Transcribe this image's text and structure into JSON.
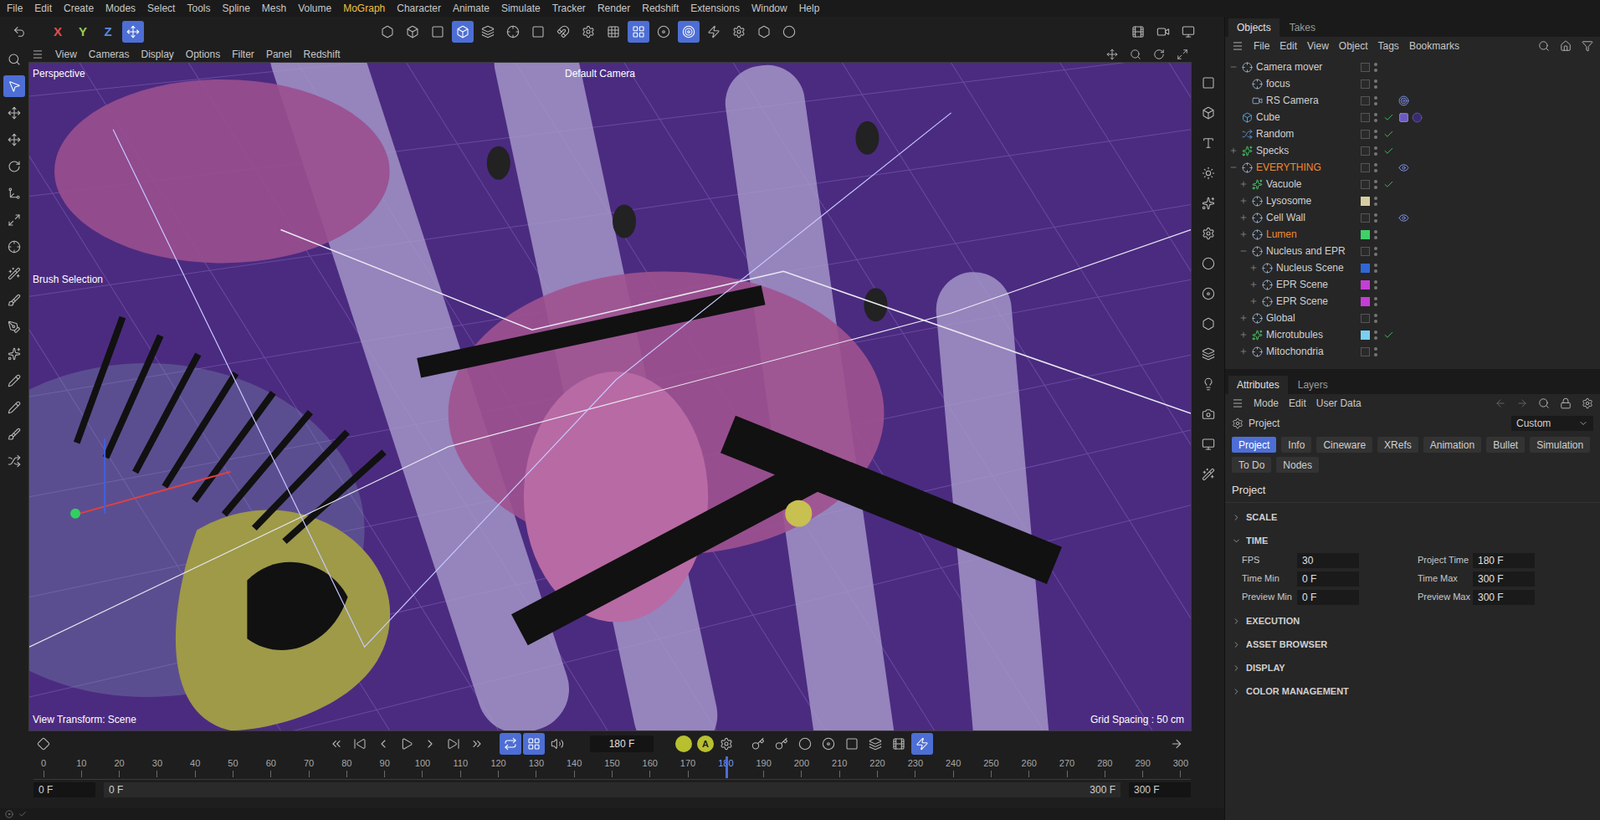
{
  "menu": [
    {
      "label": "File",
      "highlight": false
    },
    {
      "label": "Edit",
      "highlight": false
    },
    {
      "label": "Create",
      "highlight": false
    },
    {
      "label": "Modes",
      "highlight": false
    },
    {
      "label": "Select",
      "highlight": false
    },
    {
      "label": "Tools",
      "highlight": false
    },
    {
      "label": "Spline",
      "highlight": false
    },
    {
      "label": "Mesh",
      "highlight": false
    },
    {
      "label": "Volume",
      "highlight": false
    },
    {
      "label": "MoGraph",
      "highlight": true
    },
    {
      "label": "Character",
      "highlight": false
    },
    {
      "label": "Animate",
      "highlight": false
    },
    {
      "label": "Simulate",
      "highlight": false
    },
    {
      "label": "Tracker",
      "highlight": false
    },
    {
      "label": "Render",
      "highlight": false
    },
    {
      "label": "Redshift",
      "highlight": false
    },
    {
      "label": "Extensions",
      "highlight": false
    },
    {
      "label": "Window",
      "highlight": false
    },
    {
      "label": "Help",
      "highlight": false
    }
  ],
  "toolbar": {
    "axes": [
      {
        "label": "X",
        "color": "#e05050"
      },
      {
        "label": "Y",
        "color": "#9cc85a"
      },
      {
        "label": "Z",
        "color": "#5a8ae0"
      }
    ]
  },
  "viewport": {
    "menu": [
      "View",
      "Cameras",
      "Display",
      "Options",
      "Filter",
      "Panel",
      "Redshift"
    ],
    "label": "Perspective",
    "camera": "Default Camera",
    "tool": "Brush Selection",
    "view_transform": "View Transform: Scene",
    "grid": "Grid Spacing : 50 cm"
  },
  "objects": {
    "tabs": [
      {
        "label": "Objects",
        "selected": true
      },
      {
        "label": "Takes",
        "selected": false
      }
    ],
    "menu": [
      "File",
      "Edit",
      "View",
      "Object",
      "Tags",
      "Bookmarks"
    ],
    "items": [
      {
        "name": "Camera mover",
        "depth": 0,
        "expandable": true,
        "expanded": true,
        "highlight": false,
        "kind": "null",
        "color": null,
        "checked": false,
        "tags": []
      },
      {
        "name": "focus",
        "depth": 1,
        "expandable": false,
        "expanded": false,
        "highlight": false,
        "kind": "null",
        "color": null,
        "checked": false,
        "tags": []
      },
      {
        "name": "RS Camera",
        "depth": 1,
        "expandable": false,
        "expanded": false,
        "highlight": false,
        "kind": "camera",
        "color": null,
        "checked": false,
        "tags": [
          "target"
        ]
      },
      {
        "name": "Cube",
        "depth": 0,
        "expandable": false,
        "expanded": false,
        "highlight": false,
        "kind": "cube",
        "color": null,
        "checked": true,
        "tags": [
          "material",
          "sphere"
        ]
      },
      {
        "name": "Random",
        "depth": 0,
        "expandable": false,
        "expanded": false,
        "highlight": false,
        "kind": "effector",
        "color": null,
        "checked": true,
        "tags": []
      },
      {
        "name": "Specks",
        "depth": 0,
        "expandable": true,
        "expanded": false,
        "highlight": false,
        "kind": "emitter",
        "color": null,
        "checked": true,
        "tags": []
      },
      {
        "name": "EVERYTHING",
        "depth": 0,
        "expandable": true,
        "expanded": true,
        "highlight": true,
        "kind": "null",
        "color": null,
        "checked": false,
        "tags": [
          "eye"
        ]
      },
      {
        "name": "Vacuole",
        "depth": 1,
        "expandable": true,
        "expanded": false,
        "highlight": false,
        "kind": "emitter",
        "color": null,
        "checked": true,
        "tags": []
      },
      {
        "name": "Lysosome",
        "depth": 1,
        "expandable": true,
        "expanded": false,
        "highlight": false,
        "kind": "null",
        "color": "#d8cda2",
        "checked": false,
        "tags": []
      },
      {
        "name": "Cell Wall",
        "depth": 1,
        "expandable": true,
        "expanded": false,
        "highlight": false,
        "kind": "null",
        "color": null,
        "checked": false,
        "tags": [
          "eye"
        ]
      },
      {
        "name": "Lumen",
        "depth": 1,
        "expandable": true,
        "expanded": false,
        "highlight": true,
        "kind": "null",
        "color": "#3fd068",
        "checked": false,
        "tags": []
      },
      {
        "name": "Nucleus and EPR",
        "depth": 1,
        "expandable": true,
        "expanded": true,
        "highlight": false,
        "kind": "null",
        "color": null,
        "checked": false,
        "tags": []
      },
      {
        "name": "Nucleus Scene",
        "depth": 2,
        "expandable": true,
        "expanded": false,
        "highlight": false,
        "kind": "null",
        "color": "#3067d6",
        "checked": false,
        "tags": []
      },
      {
        "name": "EPR Scene",
        "depth": 2,
        "expandable": true,
        "expanded": false,
        "highlight": false,
        "kind": "null",
        "color": "#c53ed6",
        "checked": false,
        "tags": []
      },
      {
        "name": "EPR Scene",
        "depth": 2,
        "expandable": true,
        "expanded": false,
        "highlight": false,
        "kind": "null",
        "color": "#c53ed6",
        "checked": false,
        "tags": []
      },
      {
        "name": "Global",
        "depth": 1,
        "expandable": true,
        "expanded": false,
        "highlight": false,
        "kind": "null",
        "color": null,
        "checked": false,
        "tags": []
      },
      {
        "name": "Microtubules",
        "depth": 1,
        "expandable": true,
        "expanded": false,
        "highlight": false,
        "kind": "emitter",
        "color": "#7ad0f0",
        "checked": true,
        "tags": []
      },
      {
        "name": "Mitochondria",
        "depth": 1,
        "expandable": true,
        "expanded": false,
        "highlight": false,
        "kind": "null",
        "color": null,
        "checked": false,
        "tags": []
      }
    ]
  },
  "attributes": {
    "tabs": [
      {
        "label": "Attributes",
        "selected": true
      },
      {
        "label": "Layers",
        "selected": false
      }
    ],
    "menu": [
      "Mode",
      "Edit",
      "User Data"
    ],
    "object": "Project",
    "preset": "Custom",
    "pages": [
      {
        "label": "Project",
        "selected": true
      },
      {
        "label": "Info",
        "selected": false
      },
      {
        "label": "Cineware",
        "selected": false
      },
      {
        "label": "XRefs",
        "selected": false
      },
      {
        "label": "Animation",
        "selected": false
      },
      {
        "label": "Bullet",
        "selected": false
      },
      {
        "label": "Simulation",
        "selected": false
      },
      {
        "label": "To Do",
        "selected": false
      },
      {
        "label": "Nodes",
        "selected": false
      }
    ],
    "heading": "Project",
    "sections": [
      {
        "label": "SCALE",
        "expanded": false,
        "fields": []
      },
      {
        "label": "TIME",
        "expanded": true,
        "fields": [
          {
            "label": "FPS",
            "value": "30"
          },
          {
            "label": "Project Time",
            "value": "180 F"
          },
          {
            "label": "Time Min",
            "value": "0 F"
          },
          {
            "label": "Time Max",
            "value": "300 F"
          },
          {
            "label": "Preview Min",
            "value": "0 F"
          },
          {
            "label": "Preview Max",
            "value": "300 F"
          }
        ]
      },
      {
        "label": "EXECUTION",
        "expanded": false,
        "fields": []
      },
      {
        "label": "ASSET BROWSER",
        "expanded": false,
        "fields": []
      },
      {
        "label": "DISPLAY",
        "expanded": false,
        "fields": []
      },
      {
        "label": "COLOR MANAGEMENT",
        "expanded": false,
        "fields": []
      }
    ]
  },
  "timeline": {
    "frame": "180 F",
    "auto_key": "A",
    "ticks": [
      "0",
      "10",
      "20",
      "30",
      "40",
      "50",
      "60",
      "70",
      "80",
      "90",
      "100",
      "110",
      "120",
      "130",
      "140",
      "150",
      "160",
      "170",
      "180",
      "190",
      "200",
      "210",
      "220",
      "230",
      "240",
      "250",
      "260",
      "270",
      "280",
      "290",
      "300"
    ],
    "playhead": {
      "label": "180",
      "level": 0.6
    },
    "range": {
      "start": "0 F",
      "preview_start": "0 F",
      "preview_end": "300 F",
      "end": "300 F"
    }
  }
}
